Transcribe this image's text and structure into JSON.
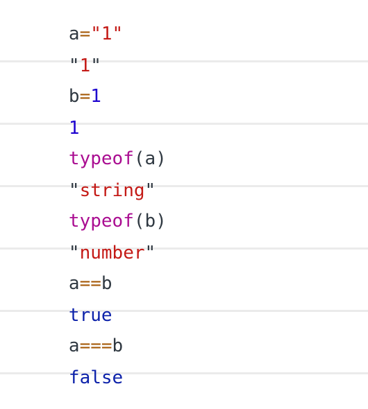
{
  "console": {
    "entries": [
      {
        "input": [
          {
            "text": "a",
            "kind": "default"
          },
          {
            "text": "=",
            "kind": "op"
          },
          {
            "text": "\"1\"",
            "kind": "str"
          }
        ],
        "output": [
          {
            "text": "\"",
            "kind": "quote"
          },
          {
            "text": "1",
            "kind": "str"
          },
          {
            "text": "\"",
            "kind": "quote"
          }
        ]
      },
      {
        "input": [
          {
            "text": "b",
            "kind": "default"
          },
          {
            "text": "=",
            "kind": "op"
          },
          {
            "text": "1",
            "kind": "num"
          }
        ],
        "output": [
          {
            "text": "1",
            "kind": "num"
          }
        ]
      },
      {
        "input": [
          {
            "text": "typeof",
            "kind": "kw"
          },
          {
            "text": "(",
            "kind": "paren"
          },
          {
            "text": "a",
            "kind": "default"
          },
          {
            "text": ")",
            "kind": "paren"
          }
        ],
        "output": [
          {
            "text": "\"",
            "kind": "quote"
          },
          {
            "text": "string",
            "kind": "str"
          },
          {
            "text": "\"",
            "kind": "quote"
          }
        ]
      },
      {
        "input": [
          {
            "text": "typeof",
            "kind": "kw"
          },
          {
            "text": "(",
            "kind": "paren"
          },
          {
            "text": "b",
            "kind": "default"
          },
          {
            "text": ")",
            "kind": "paren"
          }
        ],
        "output": [
          {
            "text": "\"",
            "kind": "quote"
          },
          {
            "text": "number",
            "kind": "str"
          },
          {
            "text": "\"",
            "kind": "quote"
          }
        ]
      },
      {
        "input": [
          {
            "text": "a",
            "kind": "default"
          },
          {
            "text": "==",
            "kind": "op"
          },
          {
            "text": "b",
            "kind": "default"
          }
        ],
        "output": [
          {
            "text": "true",
            "kind": "bool"
          }
        ]
      },
      {
        "input": [
          {
            "text": "a",
            "kind": "default"
          },
          {
            "text": "===",
            "kind": "op"
          },
          {
            "text": "b",
            "kind": "default"
          }
        ],
        "output": [
          {
            "text": "false",
            "kind": "bool"
          }
        ]
      }
    ]
  },
  "colors": {
    "default": "#303942",
    "op": "#a55a08",
    "str": "#c41a16",
    "num": "#1c00cf",
    "kw": "#aa0d91",
    "bool": "#0d22aa",
    "divider": "#ebebeb"
  }
}
